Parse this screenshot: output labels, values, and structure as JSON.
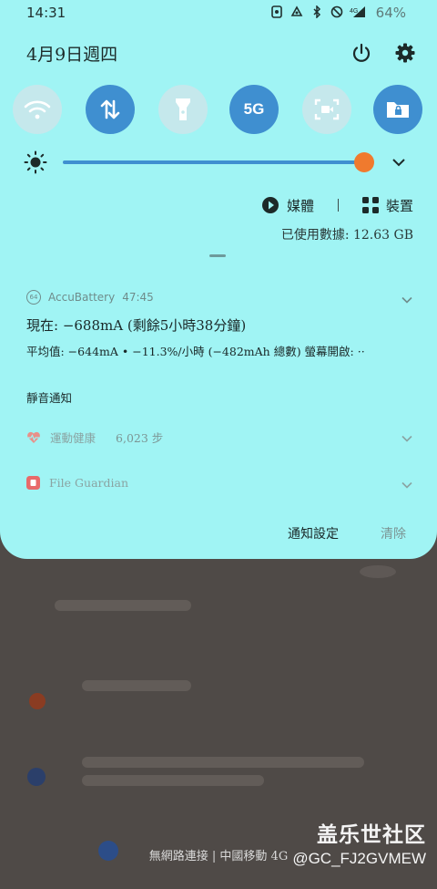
{
  "status_bar": {
    "time": "14:31",
    "battery": "64%",
    "icons": [
      "screenshot-icon",
      "cloud-icon",
      "bluetooth-icon",
      "mute-icon",
      "signal-icon"
    ]
  },
  "header": {
    "date": "4月9日週四",
    "power_icon": "power-icon",
    "settings_icon": "gear-icon"
  },
  "quick_settings": {
    "tiles": [
      {
        "name": "wifi",
        "state": "off",
        "icon": "wifi-icon"
      },
      {
        "name": "mobile-data",
        "state": "on",
        "icon": "data-arrows-icon"
      },
      {
        "name": "flashlight",
        "state": "off",
        "icon": "flashlight-icon"
      },
      {
        "name": "5g",
        "state": "on",
        "label": "5G"
      },
      {
        "name": "screen-recorder",
        "state": "off",
        "icon": "screen-record-icon"
      },
      {
        "name": "secure-folder",
        "state": "on",
        "icon": "secure-folder-icon"
      }
    ],
    "brightness_level": 0.97,
    "colors": {
      "on": "#3f8fd0",
      "off": "#c5e8ec",
      "thumb": "#f07a2e",
      "panel": "#a0f4f4"
    }
  },
  "media": {
    "media_label": "媒體",
    "devices_label": "裝置"
  },
  "data_usage": "已使用數據: 12.63 GB",
  "notifications": {
    "accubattery": {
      "app_name": "AccuBattery",
      "time": "47:45",
      "badge": "64",
      "title": "現在: −688mA (剩餘5小時38分鐘)",
      "body": "平均值: −644mA • −11.3%/小時 (−482mAh 總數) 螢幕開啟: ··"
    },
    "silent_label": "靜音通知",
    "silent_items": [
      {
        "app_name": "運動健康",
        "detail": "6,023 步"
      },
      {
        "app_name": "File Guardian",
        "detail": ""
      }
    ],
    "footer": {
      "settings_label": "通知設定",
      "clear_label": "清除"
    }
  },
  "background": {
    "network_status": "無網路連接 | 中國移動 4G"
  },
  "watermark": {
    "line1": "盖乐世社区",
    "line2": "@GC_FJ2GVMEW"
  }
}
